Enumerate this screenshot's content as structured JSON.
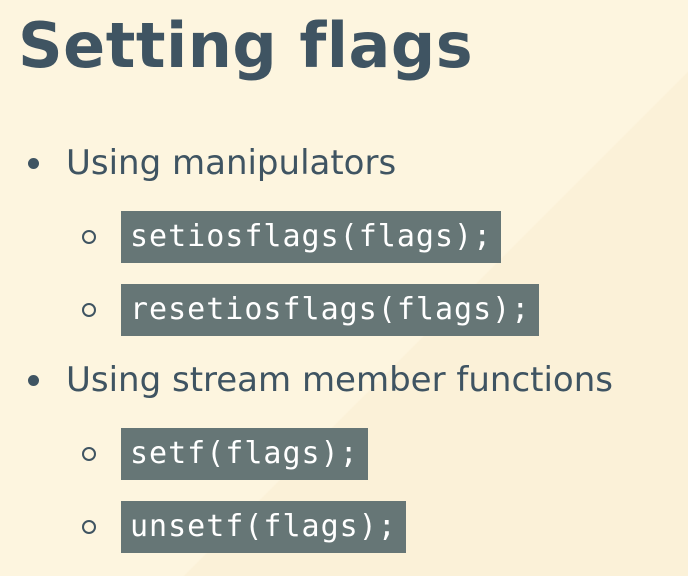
{
  "slide": {
    "title": "Setting flags",
    "bullets": [
      {
        "text": "Using manipulators",
        "sub_items": [
          {
            "code": "setiosflags(flags);"
          },
          {
            "code": "resetiosflags(flags);"
          }
        ]
      },
      {
        "text": "Using stream member functions",
        "sub_items": [
          {
            "code": "setf(flags);"
          },
          {
            "code": "unsetf(flags);"
          }
        ]
      }
    ]
  },
  "colors": {
    "background": "#fdf5e0",
    "text": "#3f5462",
    "code_background": "#667676",
    "code_text": "#ffffff"
  },
  "icons": {
    "level1_marker": "filled-disc-bullet",
    "level2_marker": "hollow-circle-bullet"
  }
}
